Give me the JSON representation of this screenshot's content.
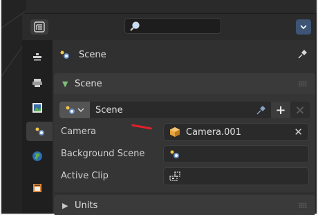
{
  "context": {
    "label": "Scene"
  },
  "scene_panel": {
    "title": "Scene",
    "selector_value": "Scene",
    "camera_label": "Camera",
    "camera_value": "Camera.001",
    "background_scene_label": "Background Scene",
    "background_scene_value": "",
    "active_clip_label": "Active Clip",
    "active_clip_value": ""
  },
  "units_panel": {
    "title": "Units"
  },
  "colors": {
    "accent_blue": "#3e5474",
    "annotation_red": "#e0202a",
    "camera_orange": "#e8a33a"
  },
  "icons": {
    "editor_type": "properties-editor-icon",
    "search": "search-icon",
    "options": "chevron-down-icon",
    "pin": "pin-icon",
    "add": "plus-icon",
    "remove": "close-icon"
  }
}
